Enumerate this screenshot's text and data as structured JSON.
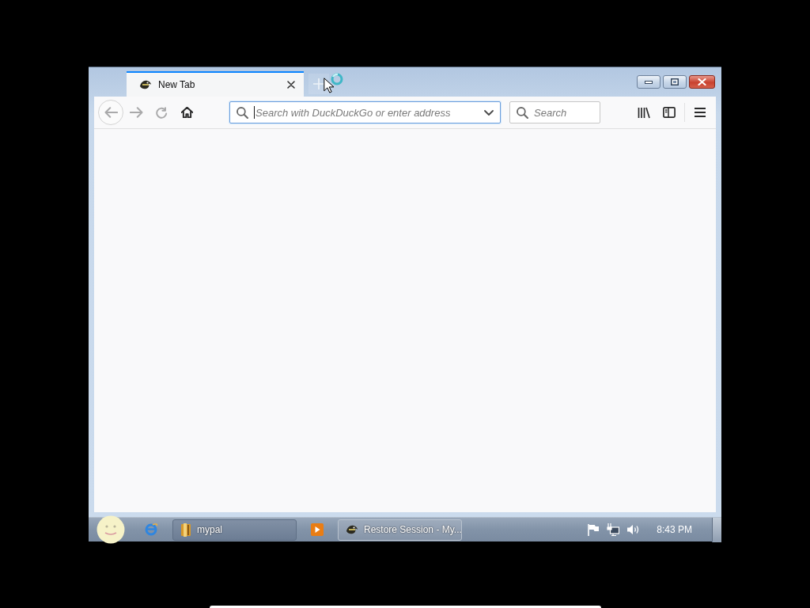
{
  "window": {
    "tabs": [
      {
        "title": "New Tab",
        "selected": true
      }
    ]
  },
  "toolbar": {
    "nav_buttons": [
      {
        "kind": "back",
        "disabled": true
      },
      {
        "kind": "forward",
        "disabled": true
      },
      {
        "kind": "reload",
        "disabled": true
      },
      {
        "kind": "home",
        "disabled": false
      }
    ],
    "address_bar": {
      "placeholder": "Search with DuckDuckGo or enter address",
      "focused": true
    },
    "search_box": {
      "placeholder": "Search"
    }
  },
  "taskbar": {
    "items": [
      {
        "kind": "browser",
        "selected": false
      },
      {
        "kind": "folder",
        "label": "mypal",
        "selected": false
      },
      {
        "kind": "media",
        "selected": false
      },
      {
        "kind": "app",
        "label": "Restore Session - My...",
        "selected": true
      }
    ],
    "clock": "8:43 PM"
  }
}
